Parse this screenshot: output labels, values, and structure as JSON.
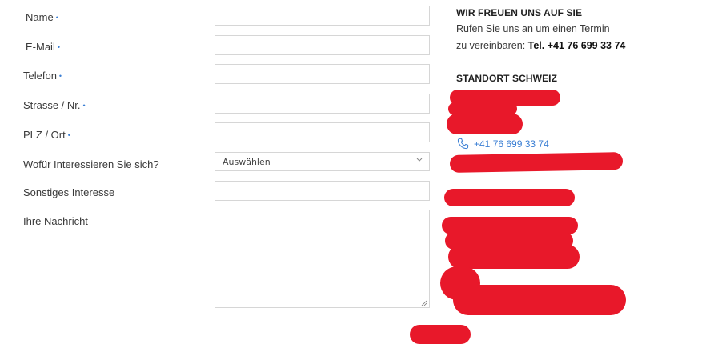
{
  "form": {
    "fields": [
      {
        "label": "Name",
        "required": "•"
      },
      {
        "label": "E-Mail",
        "required": "•"
      },
      {
        "label": "Telefon",
        "required": "•"
      },
      {
        "label": "Strasse / Nr.",
        "required": "•"
      },
      {
        "label": "PLZ / Ort",
        "required": "•"
      },
      {
        "label": "Wofür Interessieren Sie sich?"
      },
      {
        "label": "Sonstiges Interesse"
      },
      {
        "label": "Ihre Nachricht"
      }
    ],
    "select_value": "Auswählen"
  },
  "contact": {
    "heading": "WIR FREUEN UNS AUF SIE",
    "line1": "Rufen Sie uns an um einen Termin",
    "line2_prefix": "zu vereinbaren: ",
    "line2_phone": "Tel. +41 76 699 33 74",
    "location_heading": "STANDORT SCHWEIZ",
    "phone_link": "+41 76 699 33 74"
  },
  "redaction_color": "#e8182a"
}
